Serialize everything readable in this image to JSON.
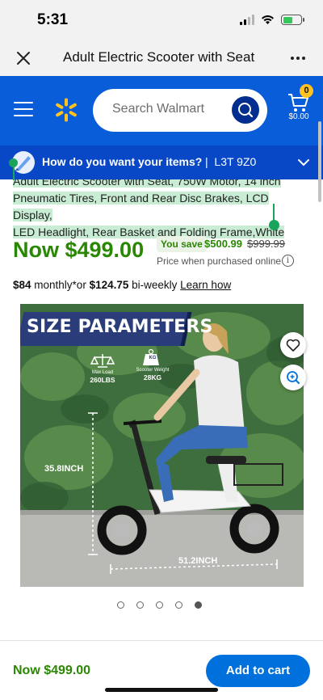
{
  "status": {
    "time": "5:31"
  },
  "titlebar": {
    "title": "Adult Electric Scooter with Seat"
  },
  "header": {
    "search_placeholder": "Search Walmart",
    "cart_count": "0",
    "cart_total": "$0.00",
    "brand_color": "#0a5dd8"
  },
  "delivery": {
    "question": "How do you want your items?",
    "separator": "|",
    "zip": "L3T 9Z0"
  },
  "product": {
    "title_line1": "Adult Electric Scooter with Seat, 750W Motor, 14 inch",
    "title_line2": "Pneumatic Tires, Front and Rear Disc Brakes, LCD Display,",
    "title_line3": "LED Headlight, Rear Basket and Folding Frame,White",
    "price_now": "Now $499.00",
    "you_save_label": "You save",
    "save_amount": "$500.99",
    "was_price": "$999.99",
    "price_note": "Price when purchased online",
    "installment_monthly": "$84",
    "installment_monthly_suffix": " monthly*or ",
    "installment_biweekly": "$124.75",
    "installment_biweekly_suffix": " bi-weekly ",
    "learn_how": "Learn how"
  },
  "image": {
    "banner": "SIZE PARAMETERS",
    "max_load_label": "Max Load",
    "max_load_value": "260LBS",
    "weight_icon_text": "KG",
    "weight_label": "Scooter Weight",
    "weight_value": "28KG",
    "height_label": "35.8INCH",
    "length_label": "51.2INCH"
  },
  "pager": {
    "count": 5,
    "active_index": 4
  },
  "bottom": {
    "price": "Now $499.00",
    "add_to_cart": "Add to cart"
  },
  "colors": {
    "price_green": "#2a8703",
    "cta_blue": "#0071dc",
    "spark_yellow": "#ffc220"
  }
}
